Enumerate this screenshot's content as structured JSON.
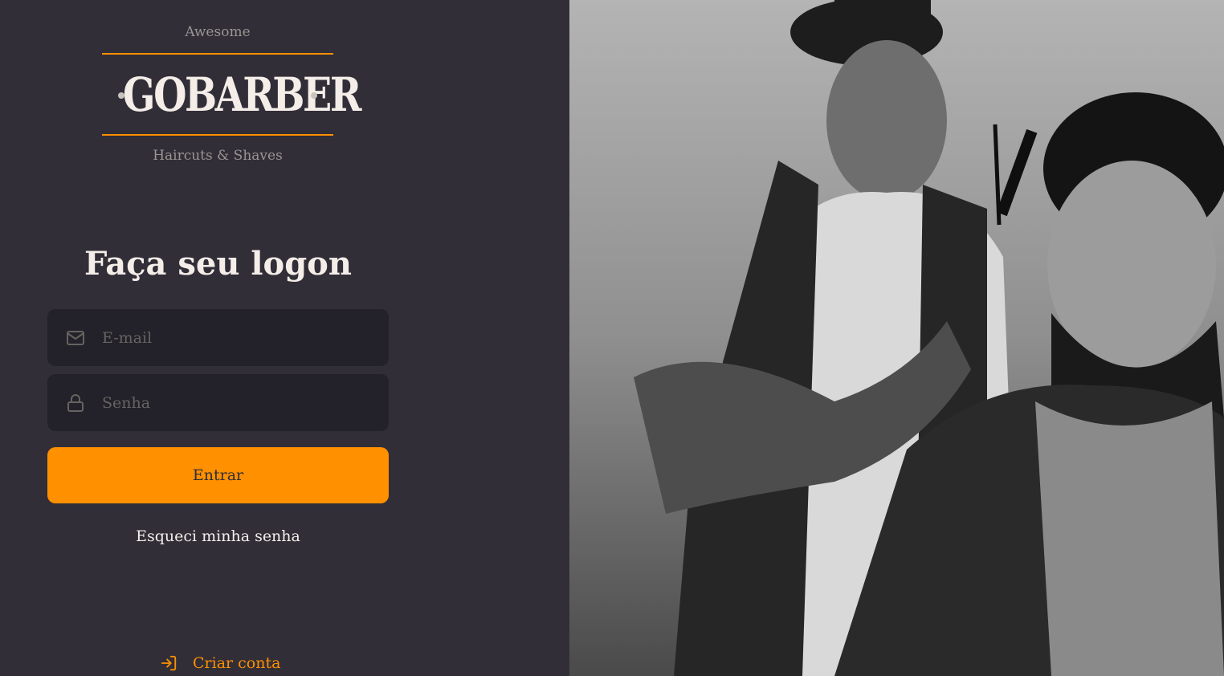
{
  "logo": {
    "top_text": "Awesome",
    "brand": "GOBARBER",
    "bottom_text": "Haircuts & Shaves"
  },
  "form": {
    "title": "Faça seu logon",
    "email": {
      "placeholder": "E-mail",
      "value": "",
      "icon": "mail-icon"
    },
    "password": {
      "placeholder": "Senha",
      "value": "",
      "icon": "lock-icon"
    },
    "submit_label": "Entrar",
    "forgot_label": "Esqueci minha senha"
  },
  "create_account": {
    "label": "Criar conta",
    "icon": "log-in-icon"
  },
  "background_image": {
    "description": "Barber cutting a bearded man's hair, black and white photo"
  },
  "colors": {
    "background": "#312e38",
    "input_bg": "#232129",
    "accent": "#ff9000",
    "text": "#f4ede8",
    "muted": "#999591",
    "placeholder": "#666360"
  }
}
